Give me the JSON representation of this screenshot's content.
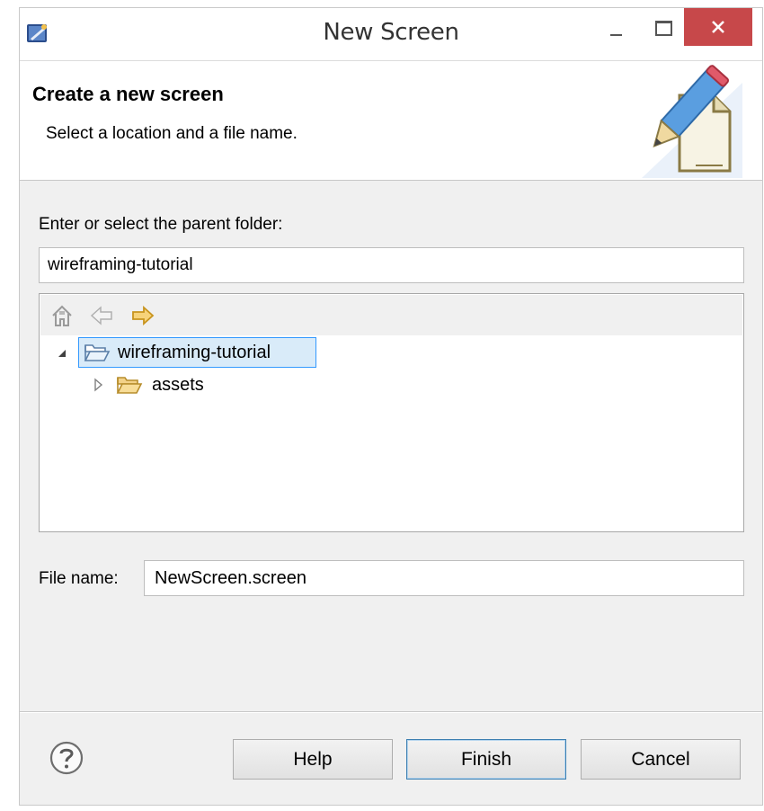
{
  "window": {
    "title": "New Screen",
    "app_icon": "eclipse-app-icon",
    "controls": [
      "minimize-icon",
      "maximize-icon",
      "close-icon"
    ]
  },
  "header": {
    "title": "Create a new screen",
    "description": "Select a location and a file name.",
    "graphic": "pencil-document-icon"
  },
  "parent_folder": {
    "label": "Enter or select the parent folder:",
    "value": "wireframing-tutorial"
  },
  "tree": {
    "toolbar": [
      "home-icon",
      "back-arrow-icon",
      "forward-arrow-icon"
    ],
    "nodes": [
      {
        "label": "wireframing-tutorial",
        "expanded": true,
        "selected": true,
        "icon": "open-folder-icon"
      },
      {
        "label": "assets",
        "expanded": false,
        "selected": false,
        "icon": "folder-icon"
      }
    ]
  },
  "file_name": {
    "label": "File name:",
    "value": "NewScreen.screen"
  },
  "buttons": {
    "help": "Help",
    "finish": "Finish",
    "cancel": "Cancel"
  },
  "colors": {
    "close_button": "#c7484a",
    "selection_bg": "#d9ebf9",
    "selection_border": "#3399ff",
    "dialog_bg": "#f0f0f0"
  }
}
